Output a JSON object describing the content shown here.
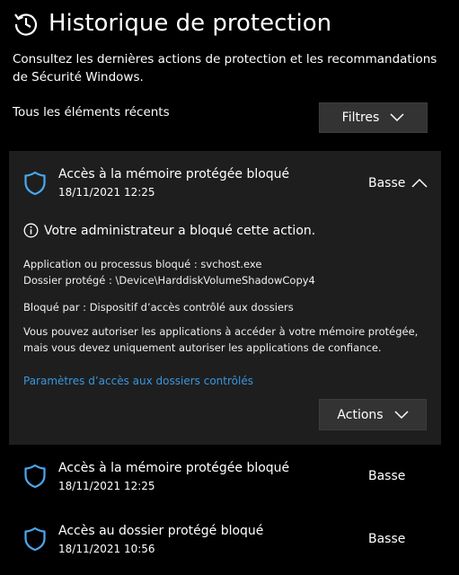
{
  "header": {
    "title": "Historique de protection",
    "subtitle": "Consultez les dernières actions de protection et les recommandations de Sécurité Windows.",
    "recent_label": "Tous les éléments récents",
    "filter_label": "Filtres"
  },
  "expanded_item": {
    "title": "Accès à la mémoire protégée bloqué",
    "date": "18/11/2021 12:25",
    "severity": "Basse",
    "info": "Votre administrateur a bloqué cette action.",
    "process_line": "Application ou processus bloqué : svchost.exe",
    "folder_line": "Dossier protégé :  \\Device\\HarddiskVolumeShadowCopy4",
    "blocked_by_line": "Bloqué par : Dispositif d’accès contrôlé aux dossiers",
    "description_line1": "Vous pouvez autoriser les applications à accéder à votre mémoire protégée,",
    "description_line2": "mais vous devez uniquement autoriser les applications de confiance.",
    "link": "Paramètres d’accès aux dossiers contrôlés",
    "actions_label": "Actions"
  },
  "items": [
    {
      "title": "Accès à la mémoire protégée bloqué",
      "date": "18/11/2021 12:25",
      "severity": "Basse"
    },
    {
      "title": "Accès au dossier protégé bloqué",
      "date": "18/11/2021 10:56",
      "severity": "Basse"
    }
  ],
  "colors": {
    "background": "#000000",
    "card": "#1e1e1e",
    "button": "#333333",
    "accent": "#3a96dd",
    "shield": "#4aa8f0"
  },
  "icons": {
    "history": "history-icon",
    "shield": "shield-icon",
    "info": "info-icon",
    "chevron_down": "chevron-down-icon",
    "chevron_up": "chevron-up-icon"
  }
}
